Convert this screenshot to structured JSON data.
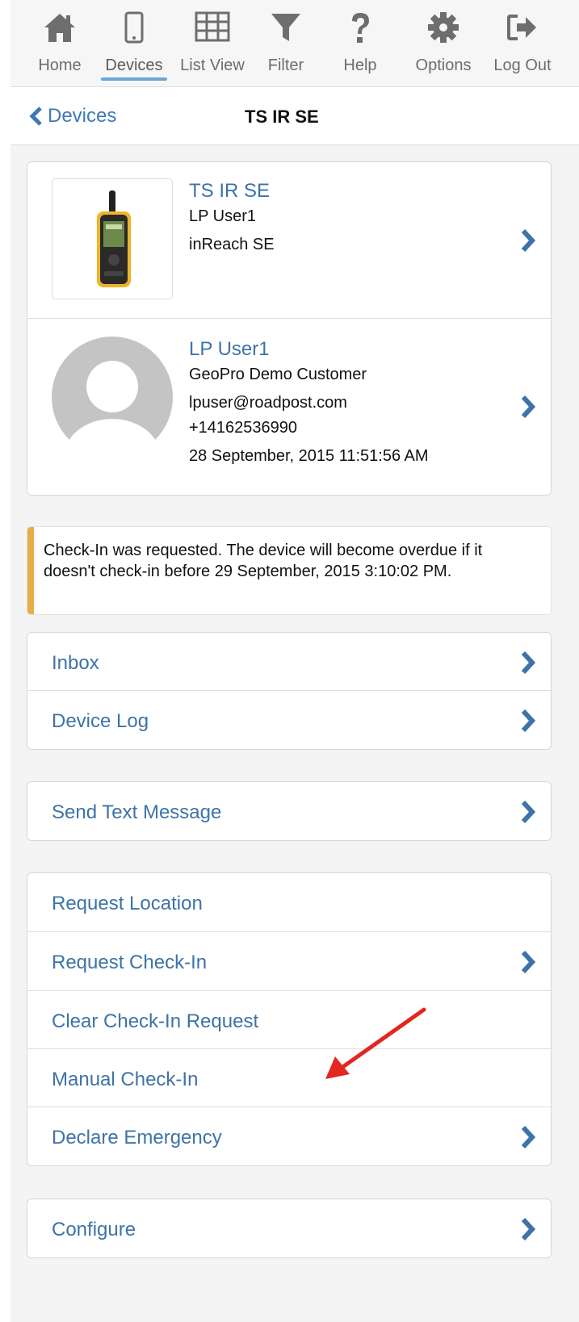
{
  "toolbar": {
    "items": [
      {
        "label": "Home",
        "icon": "home-icon"
      },
      {
        "label": "Devices",
        "icon": "phone-icon",
        "active": true
      },
      {
        "label": "List View",
        "icon": "grid-icon"
      },
      {
        "label": "Filter",
        "icon": "filter-icon"
      },
      {
        "label": "Help",
        "icon": "question-icon"
      },
      {
        "label": "Options",
        "icon": "gear-icon"
      },
      {
        "label": "Log Out",
        "icon": "logout-icon"
      }
    ]
  },
  "nav": {
    "back_label": "Devices",
    "title": "TS IR SE"
  },
  "device": {
    "name": "TS IR SE",
    "user": "LP User1",
    "model": "inReach SE"
  },
  "user": {
    "name": "LP User1",
    "company": "GeoPro Demo Customer",
    "email": "lpuser@roadpost.com",
    "phone": "+14162536990",
    "timestamp": "28 September, 2015 11:51:56 AM"
  },
  "alert": {
    "text": "Check-In was requested. The device will become overdue if it doesn't check-in before 29 September, 2015 3:10:02 PM."
  },
  "menu1": {
    "inbox": "Inbox",
    "device_log": "Device Log"
  },
  "menu2": {
    "send_text": "Send Text Message"
  },
  "menu3": {
    "request_location": "Request Location",
    "request_checkin": "Request Check-In",
    "clear_checkin": "Clear Check-In Request",
    "manual_checkin": "Manual Check-In",
    "declare_emergency": "Declare Emergency"
  },
  "menu4": {
    "configure": "Configure"
  },
  "colors": {
    "accent": "#3e73a7",
    "alert": "#e8ad4a",
    "annotation": "#e3261f"
  }
}
